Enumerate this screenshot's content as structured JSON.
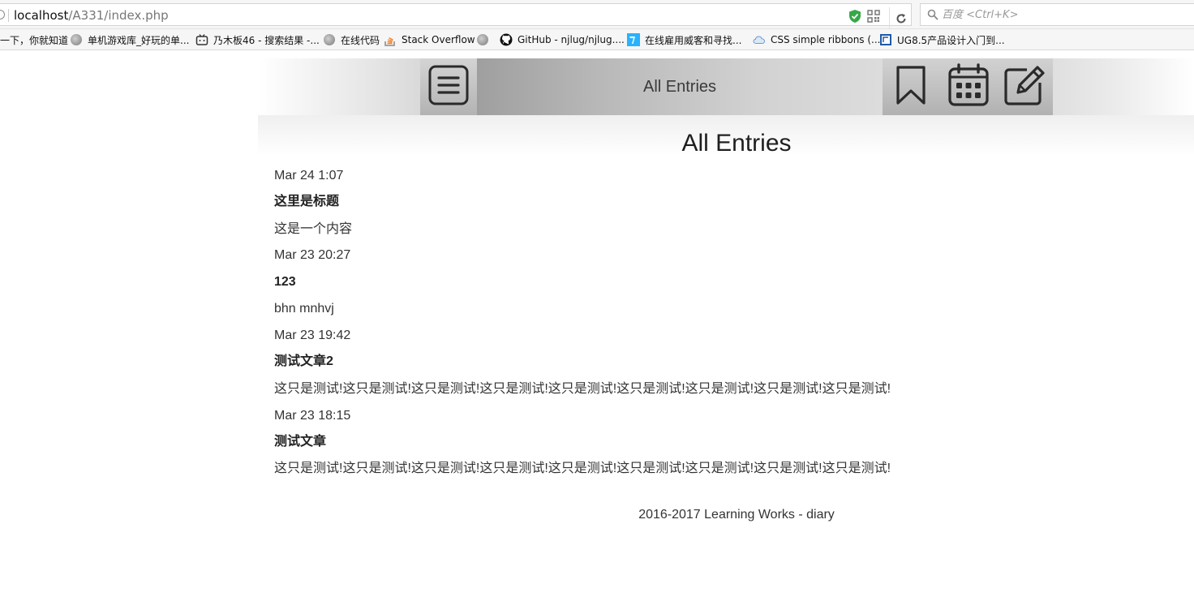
{
  "browser": {
    "url_host": "localhost",
    "url_path": "/A331/index.php",
    "search_placeholder": "百度 <Ctrl+K>",
    "bookmarks": [
      {
        "label": "一下，你就知道",
        "icon": "none"
      },
      {
        "label": "单机游戏库_好玩的单...",
        "icon": "globe-icon"
      },
      {
        "label": "乃木板46 - 搜索结果 -...",
        "icon": "bilibili-icon"
      },
      {
        "label": "在线代码",
        "icon": "globe-icon"
      },
      {
        "label": "Stack Overflow",
        "icon": "stackoverflow-icon"
      },
      {
        "label": "",
        "icon": "globe-icon"
      },
      {
        "label": "GitHub - njlug/njlug....",
        "icon": "github-icon"
      },
      {
        "label": "在线雇用威客和寻找...",
        "icon": "freelancer-icon"
      },
      {
        "label": "CSS simple ribbons (...",
        "icon": "cloud-icon"
      },
      {
        "label": "UG8.5产品设计入门到...",
        "icon": "book-icon"
      }
    ]
  },
  "header": {
    "title": "All Entries",
    "menu_icon": "hamburger-menu-icon",
    "nav_icons": [
      "bookmark-icon",
      "calendar-icon",
      "edit-icon"
    ]
  },
  "main": {
    "heading": "All Entries",
    "entries": [
      {
        "date": "Mar 24 1:07",
        "title": "这里是标题",
        "content": "这是一个内容"
      },
      {
        "date": "Mar 23 20:27",
        "title": "123",
        "content": "bhn mnhvj"
      },
      {
        "date": "Mar 23 19:42",
        "title": "测试文章2",
        "content": "这只是测试!这只是测试!这只是测试!这只是测试!这只是测试!这只是测试!这只是测试!这只是测试!这只是测试!"
      },
      {
        "date": "Mar 23 18:15",
        "title": "测试文章",
        "content": "这只是测试!这只是测试!这只是测试!这只是测试!这只是测试!这只是测试!这只是测试!这只是测试!这只是测试!"
      }
    ]
  },
  "footer": {
    "text": "2016-2017 Learning Works - diary"
  }
}
